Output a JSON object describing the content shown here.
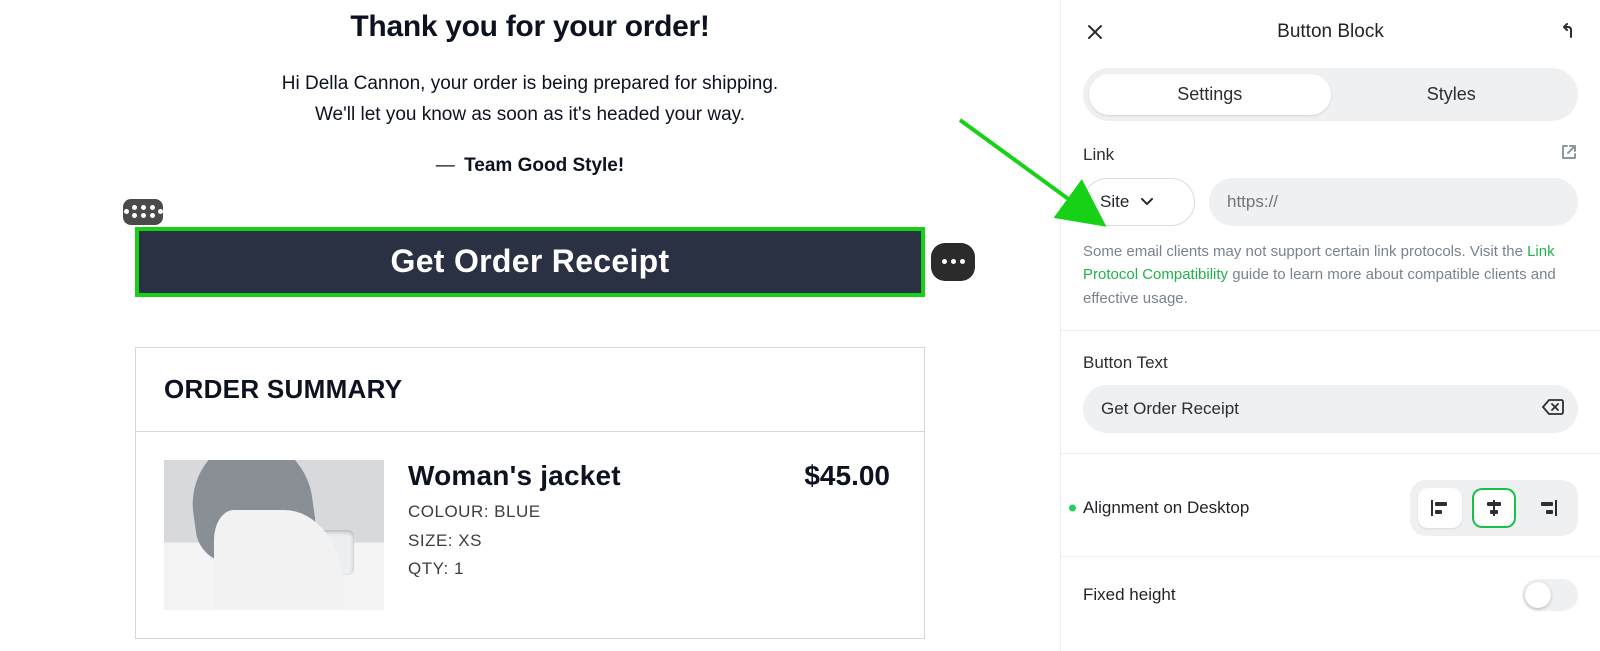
{
  "email": {
    "heading": "Thank you for your order!",
    "line1": "Hi Della Cannon, your order is being prepared for shipping.",
    "line2": "We'll let you know as soon as it's headed your way.",
    "sign_prefix": "— ",
    "sign": "Team Good Style!",
    "button_label": "Get Order Receipt",
    "summary_title": "ORDER SUMMARY",
    "item": {
      "name": "Woman's jacket",
      "colour": "COLOUR: BLUE",
      "size": "SIZE: XS",
      "qty": "QTY: 1",
      "price": "$45.00"
    }
  },
  "sidebar": {
    "title": "Button Block",
    "tabs": {
      "settings": "Settings",
      "styles": "Styles"
    },
    "link": {
      "label": "Link",
      "type_option": "Site",
      "url_placeholder": "https://",
      "hint_pre": "Some email clients may not support certain link protocols. Visit the ",
      "hint_link": "Link Protocol Compatibility",
      "hint_post": " guide to learn more about compatible clients and effective usage."
    },
    "button_text": {
      "label": "Button Text",
      "value": "Get Order Receipt"
    },
    "alignment": {
      "label": "Alignment on Desktop",
      "selected": "center"
    },
    "fixed_height": {
      "label": "Fixed height",
      "value": false
    }
  }
}
